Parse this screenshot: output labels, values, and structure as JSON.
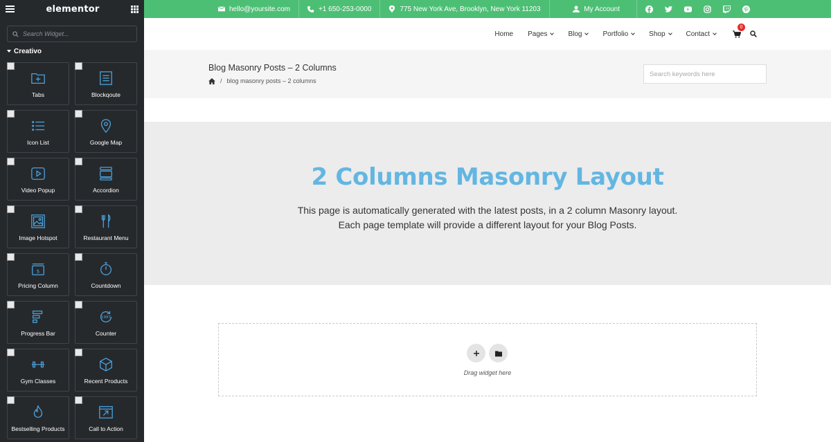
{
  "sidebar": {
    "logo": "elementor",
    "search_placeholder": "Search Widget...",
    "category": "Creativo",
    "widgets": [
      {
        "label": "Tabs",
        "icon": "folder-plus-icon"
      },
      {
        "label": "Blockqoute",
        "icon": "document-lines-icon"
      },
      {
        "label": "Icon List",
        "icon": "list-icon"
      },
      {
        "label": "Google Map",
        "icon": "map-pin-icon"
      },
      {
        "label": "Video Popup",
        "icon": "play-button-icon"
      },
      {
        "label": "Accordion",
        "icon": "accordion-icon"
      },
      {
        "label": "Image Hotspot",
        "icon": "image-icon"
      },
      {
        "label": "Restaurant Menu",
        "icon": "cutlery-icon"
      },
      {
        "label": "Pricing Column",
        "icon": "price-tag-icon"
      },
      {
        "label": "Countdown",
        "icon": "stopwatch-icon"
      },
      {
        "label": "Progress Bar",
        "icon": "progress-bar-icon"
      },
      {
        "label": "Counter",
        "icon": "counter-icon"
      },
      {
        "label": "Gym Classes",
        "icon": "dumbbell-icon"
      },
      {
        "label": "Recent Products",
        "icon": "cube-icon"
      },
      {
        "label": "Bestselling Products",
        "icon": "flame-icon"
      },
      {
        "label": "Call to Action",
        "icon": "window-arrow-icon"
      }
    ]
  },
  "topbar": {
    "email": "hello@yoursite.com",
    "phone": "+1 650-253-0000",
    "address": "775 New York Ave, Brooklyn, New York 11203",
    "account": "My Account",
    "social": [
      "facebook-icon",
      "twitter-icon",
      "youtube-icon",
      "instagram-icon",
      "twitch-icon",
      "pinterest-icon"
    ]
  },
  "nav": {
    "items": [
      {
        "label": "Home",
        "dropdown": false
      },
      {
        "label": "Pages",
        "dropdown": true
      },
      {
        "label": "Blog",
        "dropdown": true
      },
      {
        "label": "Portfolio",
        "dropdown": true
      },
      {
        "label": "Shop",
        "dropdown": true
      },
      {
        "label": "Contact",
        "dropdown": true
      }
    ],
    "cart_count": "0"
  },
  "page": {
    "title": "Blog Masonry Posts – 2 Columns",
    "breadcrumb_sep": "/",
    "breadcrumb_current": "blog masonry posts – 2 columns",
    "search_placeholder": "Search keywords here"
  },
  "hero": {
    "title": "2 Columns Masonry Layout",
    "line1": "This page is automatically generated with the latest posts, in a 2 column Masonry layout.",
    "line2": "Each page template will provide a different layout for your Blog Posts."
  },
  "dropzone": {
    "text": "Drag widget here"
  },
  "colors": {
    "sidebar_bg": "#26292c",
    "topbar_green": "#4dbf75",
    "hero_title_blue": "#63b6e2",
    "widget_icon_blue": "#4aa3df",
    "cart_badge_red": "#e52b2b"
  }
}
